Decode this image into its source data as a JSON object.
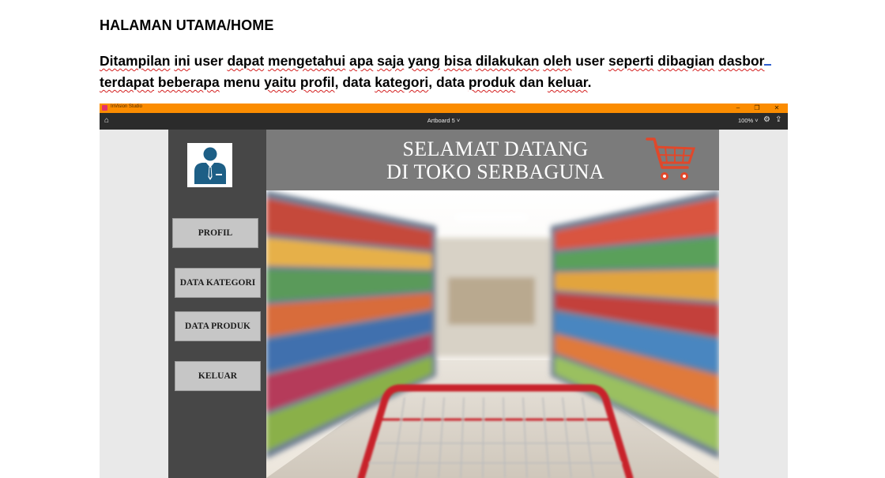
{
  "document": {
    "heading": "HALAMAN UTAMA/HOME",
    "paragraph_words": [
      {
        "text": "Ditampilan",
        "sq": true
      },
      {
        "text": " ",
        "sq": false
      },
      {
        "text": "ini",
        "sq": true
      },
      {
        "text": " user ",
        "sq": false
      },
      {
        "text": "dapat",
        "sq": true
      },
      {
        "text": " ",
        "sq": false
      },
      {
        "text": "mengetahui",
        "sq": true
      },
      {
        "text": " ",
        "sq": false
      },
      {
        "text": "apa",
        "sq": true
      },
      {
        "text": " ",
        "sq": false
      },
      {
        "text": "saja",
        "sq": true
      },
      {
        "text": " ",
        "sq": false
      },
      {
        "text": "yang",
        "sq": true
      },
      {
        "text": " ",
        "sq": false
      },
      {
        "text": "bisa",
        "sq": true
      },
      {
        "text": " ",
        "sq": false
      },
      {
        "text": "dilakukan",
        "sq": true
      },
      {
        "text": " ",
        "sq": false
      },
      {
        "text": "oleh",
        "sq": true
      },
      {
        "text": " user ",
        "sq": false
      },
      {
        "text": "seperti",
        "sq": true
      },
      {
        "text": " ",
        "sq": false
      },
      {
        "text": "dibagian",
        "sq": true
      },
      {
        "text": " ",
        "sq": false
      },
      {
        "text": "dasbor",
        "sq": true
      },
      {
        "text": " ",
        "sq": false
      },
      {
        "text": "terdapat",
        "sq": true
      },
      {
        "text": " ",
        "sq": false
      },
      {
        "text": "beberapa",
        "sq": true
      },
      {
        "text": " menu ",
        "sq": false
      },
      {
        "text": "yaitu",
        "sq": true
      },
      {
        "text": " ",
        "sq": false
      },
      {
        "text": "profil",
        "sq": true
      },
      {
        "text": ", data ",
        "sq": false
      },
      {
        "text": "kategori",
        "sq": true
      },
      {
        "text": ", data ",
        "sq": false
      },
      {
        "text": "produk",
        "sq": true
      },
      {
        "text": " dan ",
        "sq": false
      },
      {
        "text": "keluar",
        "sq": true
      },
      {
        "text": ".",
        "sq": false
      }
    ]
  },
  "window": {
    "app_title": "InVision Studio",
    "artboard_label": "Artboard 5 ˅",
    "zoom": "100% ˅",
    "title_color": "#fb8c00",
    "toolbar_color": "#2b2b2b"
  },
  "artboard": {
    "welcome_line1": "SELAMAT DATANG",
    "welcome_line2": "DI TOKO SERBAGUNA",
    "menu": [
      {
        "label": "PROFIL"
      },
      {
        "label": "DATA KATEGORI"
      },
      {
        "label": "DATA PRODUK"
      },
      {
        "label": "KELUAR"
      }
    ],
    "colors": {
      "sidebar": "#474747",
      "header": "#7b7b7b",
      "button": "#c6c6c6",
      "avatar_blue": "#1d5f86",
      "cart_red": "#e0482b"
    },
    "icons": [
      "user-avatar-icon",
      "shopping-cart-icon"
    ]
  }
}
